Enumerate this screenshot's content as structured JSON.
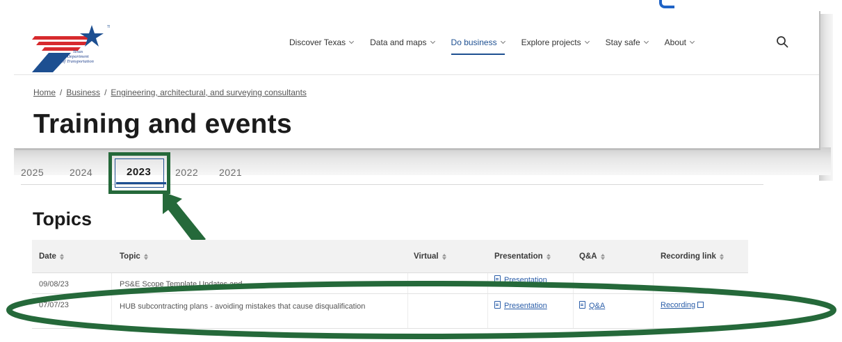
{
  "site": {
    "logo_text": [
      "Texas",
      "Department",
      "of Transportation"
    ],
    "colors": {
      "brand_blue": "#1d4f91",
      "brand_red": "#d72a2e",
      "annotation_green": "#25693a",
      "link_blue": "#2a5da8"
    }
  },
  "nav": {
    "items": [
      {
        "label": "Discover Texas",
        "active": false
      },
      {
        "label": "Data and maps",
        "active": false
      },
      {
        "label": "Do business",
        "active": true
      },
      {
        "label": "Explore projects",
        "active": false
      },
      {
        "label": "Stay safe",
        "active": false
      },
      {
        "label": "About",
        "active": false
      }
    ],
    "search_icon": "search-icon"
  },
  "breadcrumb": {
    "items": [
      "Home",
      "Business",
      "Engineering, architectural, and surveying consultants"
    ],
    "separator": "/"
  },
  "page": {
    "title": "Training and events",
    "section_title": "Topics"
  },
  "tabs": {
    "items": [
      "2025",
      "2024",
      "2023",
      "2022",
      "2021"
    ],
    "selected": "2023"
  },
  "table": {
    "headers": [
      "Date",
      "Topic",
      "Virtual",
      "Presentation",
      "Q&A",
      "Recording link"
    ],
    "rows": [
      {
        "date": "09/08/23",
        "topic": "PS&E Scope Template Updates and ...",
        "virtual": "",
        "presentation": "Presentation",
        "qa": "",
        "recording": ""
      },
      {
        "date": "07/07/23",
        "topic": "HUB subcontracting plans - avoiding mistakes that cause disqualification",
        "virtual": "",
        "presentation": "Presentation",
        "qa": "Q&A",
        "recording": "Recording"
      }
    ]
  }
}
